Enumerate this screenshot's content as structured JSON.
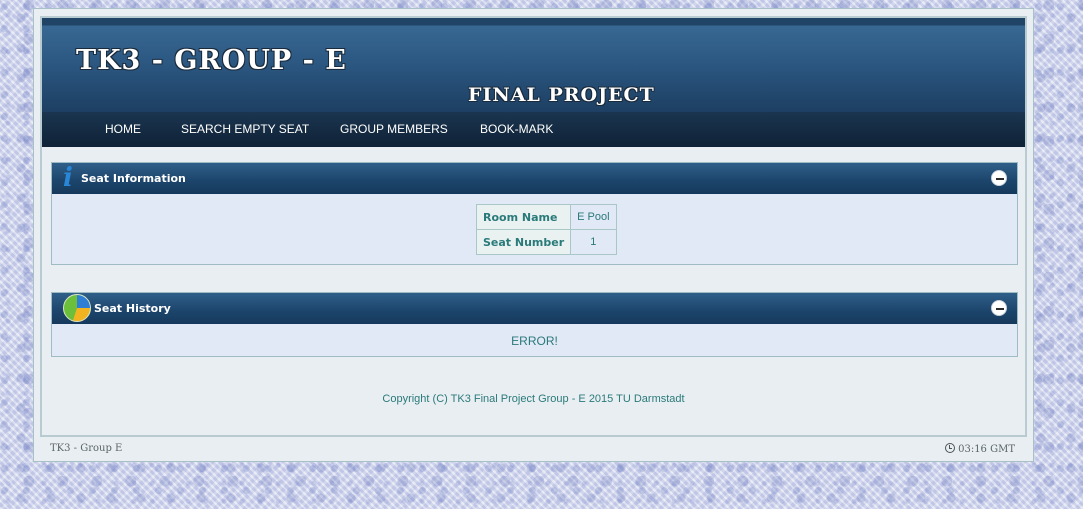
{
  "header": {
    "title": "TK3 - GROUP - E",
    "subtitle": "FINAL PROJECT"
  },
  "nav": {
    "items": [
      {
        "label": "HOME"
      },
      {
        "label": "SEARCH EMPTY SEAT"
      },
      {
        "label": "GROUP MEMBERS"
      },
      {
        "label": "BOOK-MARK"
      }
    ]
  },
  "seat_info": {
    "title": "Seat Information",
    "icon": "info-icon",
    "rows": [
      {
        "label": "Room Name",
        "value": "E Pool"
      },
      {
        "label": "Seat Number",
        "value": "1"
      }
    ]
  },
  "seat_history": {
    "title": "Seat History",
    "icon": "pie-chart-icon",
    "message": "ERROR!"
  },
  "copyright": "Copyright (C) TK3 Final Project Group - E 2015 TU Darmstadt",
  "footer": {
    "left": "TK3 - Group E",
    "time": "03:16 GMT"
  },
  "colors": {
    "header_blue": "#2d5a84",
    "nav_dark": "#0f2236",
    "text_teal": "#2a7a7a",
    "panel_bg": "#e1e8f6"
  }
}
